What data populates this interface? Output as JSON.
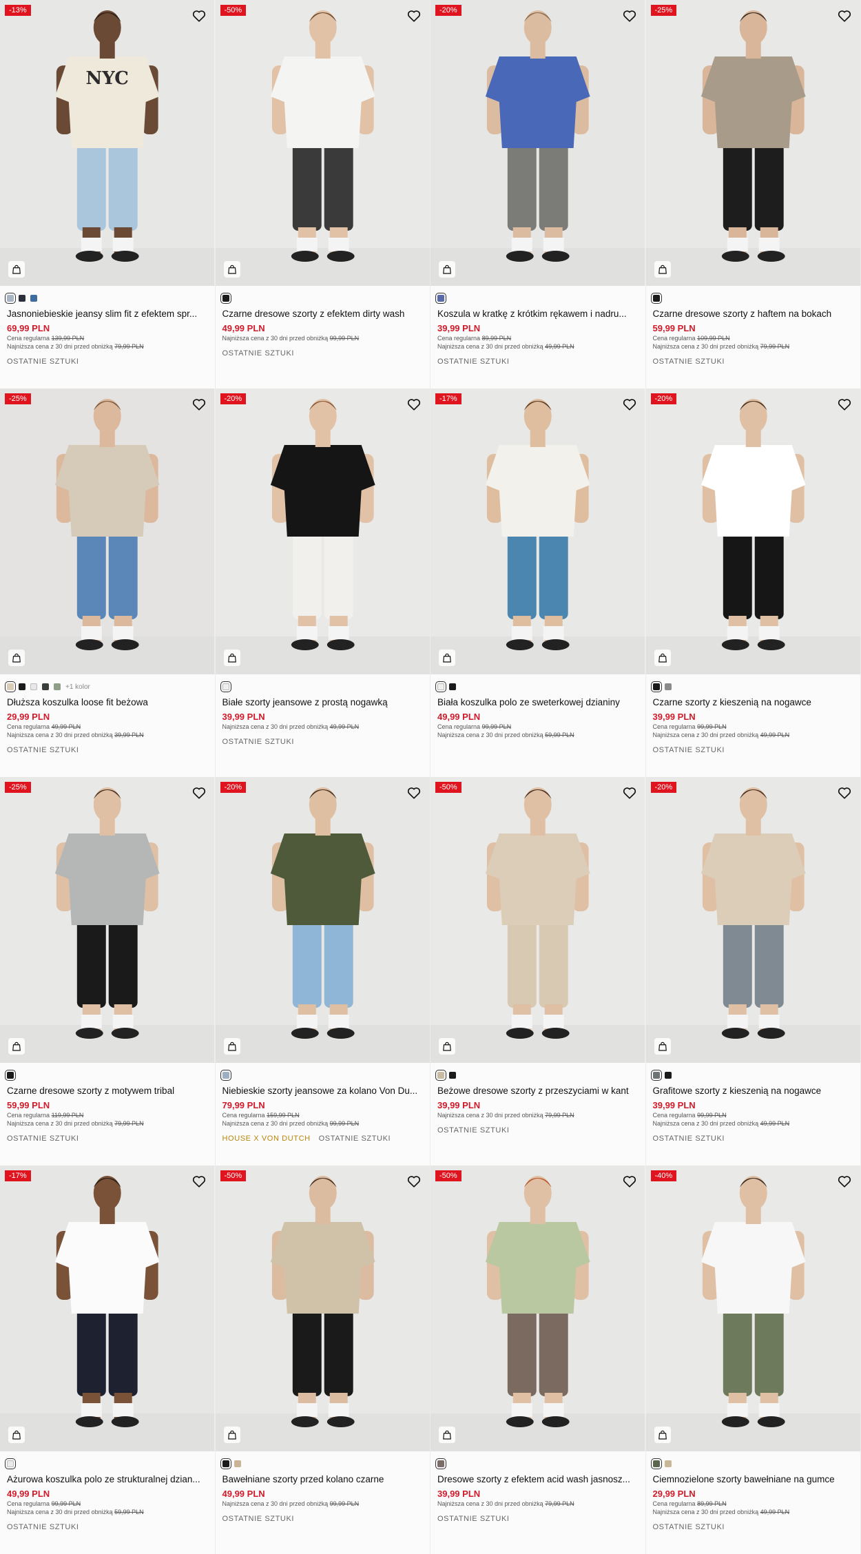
{
  "labels": {
    "regular": "Cena regularna",
    "lowest": "Najniższa cena z 30 dni przed obniżką"
  },
  "products": [
    {
      "badge": "-13%",
      "name": "Jasnoniebieskie jeansy slim fit z efektem spr...",
      "price": "69,99 PLN",
      "regular": "139,99 PLN",
      "lowest": "79,99 PLN",
      "tags": [
        "OSTATNIE SZTUKI"
      ],
      "swatches": [
        "#a8b6c4",
        "#2a2f3a",
        "#3e6c9c"
      ],
      "more": "",
      "top": "#efe9dc",
      "bottom": "#a9c6dc",
      "skin": "#6b4a35",
      "hair": "#2a1d16",
      "bg": "#e7e7e5",
      "print": "NYC"
    },
    {
      "badge": "-50%",
      "name": "Czarne dresowe szorty z efektem dirty wash",
      "price": "49,99 PLN",
      "regular": "",
      "lowest": "99,99 PLN",
      "tags": [
        "OSTATNIE SZTUKI"
      ],
      "swatches": [
        "#1b1b1b"
      ],
      "more": "",
      "top": "#f4f4f2",
      "bottom": "#3a3a3a",
      "skin": "#e2c2a6",
      "hair": "#6b4a2e",
      "bg": "#e9e9e7",
      "print": ""
    },
    {
      "badge": "-20%",
      "name": "Koszula w kratkę z krótkim rękawem i nadru...",
      "price": "39,99 PLN",
      "regular": "89,99 PLN",
      "lowest": "49,99 PLN",
      "tags": [
        "OSTATNIE SZTUKI"
      ],
      "swatches": [
        "#5a6aa8"
      ],
      "more": "",
      "top": "#4a68b8",
      "bottom": "#7b7b78",
      "skin": "#dcbca0",
      "hair": "#8a6a4e",
      "bg": "#e6e6e4",
      "print": ""
    },
    {
      "badge": "-25%",
      "name": "Czarne dresowe szorty z haftem na bokach",
      "price": "59,99 PLN",
      "regular": "109,99 PLN",
      "lowest": "79,99 PLN",
      "tags": [
        "OSTATNIE SZTUKI"
      ],
      "swatches": [
        "#1b1b1b"
      ],
      "more": "",
      "top": "#a99b8a",
      "bottom": "#1d1d1d",
      "skin": "#d9b69a",
      "hair": "#3a2a1e",
      "bg": "#e8e8e6",
      "print": ""
    },
    {
      "badge": "-25%",
      "name": "Dłuższa koszulka loose fit beżowa",
      "price": "29,99 PLN",
      "regular": "49,99 PLN",
      "lowest": "39,99 PLN",
      "tags": [
        "OSTATNIE SZTUKI"
      ],
      "swatches": [
        "#d8cdb6",
        "#1b1b1b",
        "#e8e8e8",
        "#3a3f3a",
        "#8f9e86"
      ],
      "more": "+1 kolor",
      "top": "#d6cbb8",
      "bottom": "#5a86b8",
      "skin": "#dcb89c",
      "hair": "#7a5a40",
      "bg": "#e4e3e1",
      "print": ""
    },
    {
      "badge": "-20%",
      "name": "Białe szorty jeansowe z prostą nogawką",
      "price": "39,99 PLN",
      "regular": "",
      "lowest": "49,99 PLN",
      "tags": [
        "OSTATNIE SZTUKI"
      ],
      "swatches": [
        "#eeeeec"
      ],
      "more": "",
      "top": "#151515",
      "bottom": "#f1f0ed",
      "skin": "#e2c2a6",
      "hair": "#8a5a3a",
      "bg": "#e9e9e7",
      "print": ""
    },
    {
      "badge": "-17%",
      "name": "Biała koszulka polo ze sweterkowej dzianiny",
      "price": "49,99 PLN",
      "regular": "99,99 PLN",
      "lowest": "59,99 PLN",
      "tags": [],
      "swatches": [
        "#eeeeea",
        "#1b1b1b"
      ],
      "more": "",
      "top": "#f2f1ec",
      "bottom": "#4a86b0",
      "skin": "#dfbea0",
      "hair": "#5a3a22",
      "bg": "#e8e8e6",
      "print": ""
    },
    {
      "badge": "-20%",
      "name": "Czarne szorty z kieszenią na nogawce",
      "price": "39,99 PLN",
      "regular": "99,99 PLN",
      "lowest": "49,99 PLN",
      "tags": [
        "OSTATNIE SZTUKI"
      ],
      "swatches": [
        "#1b1b1b",
        "#8a8a8a"
      ],
      "more": "",
      "top": "#ffffff",
      "bottom": "#161616",
      "skin": "#e0c0a4",
      "hair": "#4a3020",
      "bg": "#e9e9e7",
      "print": ""
    },
    {
      "badge": "-25%",
      "name": "Czarne dresowe szorty z motywem tribal",
      "price": "59,99 PLN",
      "regular": "119,99 PLN",
      "lowest": "79,99 PLN",
      "tags": [
        "OSTATNIE SZTUKI"
      ],
      "swatches": [
        "#1b1b1b"
      ],
      "more": "",
      "top": "#b5b7b6",
      "bottom": "#1a1a1a",
      "skin": "#e0c0a4",
      "hair": "#4a3020",
      "bg": "#e8e8e6",
      "print": ""
    },
    {
      "badge": "-20%",
      "name": "Niebieskie szorty jeansowe za kolano Von Du...",
      "price": "79,99 PLN",
      "regular": "159,99 PLN",
      "lowest": "99,99 PLN",
      "tags": [
        "HOUSE X VON DUTCH",
        "OSTATNIE SZTUKI"
      ],
      "swatches": [
        "#9cb0c2"
      ],
      "more": "",
      "top": "#4e5a3a",
      "bottom": "#8fb6d6",
      "skin": "#dfbfa2",
      "hair": "#4a3020",
      "bg": "#e7e7e5",
      "print": ""
    },
    {
      "badge": "-50%",
      "name": "Beżowe dresowe szorty z przeszyciami w kant",
      "price": "39,99 PLN",
      "regular": "",
      "lowest": "79,99 PLN",
      "tags": [
        "OSTATNIE SZTUKI"
      ],
      "swatches": [
        "#c9bba4",
        "#1b1b1b"
      ],
      "more": "",
      "top": "#dccdb8",
      "bottom": "#d8c9b2",
      "skin": "#e0c0a4",
      "hair": "#4a3020",
      "bg": "#e9e9e7",
      "print": ""
    },
    {
      "badge": "-20%",
      "name": "Grafitowe szorty z kieszenią na nogawce",
      "price": "39,99 PLN",
      "regular": "99,99 PLN",
      "lowest": "49,99 PLN",
      "tags": [
        "OSTATNIE SZTUKI"
      ],
      "swatches": [
        "#6e7376",
        "#1b1b1b"
      ],
      "more": "",
      "top": "#dccdb8",
      "bottom": "#7f8a92",
      "skin": "#e0c0a4",
      "hair": "#4a3020",
      "bg": "#e8e8e6",
      "print": ""
    },
    {
      "badge": "-17%",
      "name": "Ażurowa koszulka polo ze strukturalnej dzian...",
      "price": "49,99 PLN",
      "regular": "99,99 PLN",
      "lowest": "59,99 PLN",
      "tags": [
        "OSTATNIE SZTUKI"
      ],
      "swatches": [
        "#eaeaea"
      ],
      "more": "",
      "top": "#fbfbfb",
      "bottom": "#1e2230",
      "skin": "#7a5238",
      "hair": "#2a1d16",
      "bg": "#e6e6e4",
      "print": ""
    },
    {
      "badge": "-50%",
      "name": "Bawełniane szorty przed kolano czarne",
      "price": "49,99 PLN",
      "regular": "",
      "lowest": "99,99 PLN",
      "tags": [
        "OSTATNIE SZTUKI"
      ],
      "swatches": [
        "#1b1b1b",
        "#c9b498"
      ],
      "more": "",
      "top": "#cfc2a8",
      "bottom": "#1a1a1a",
      "skin": "#dcbca0",
      "hair": "#4a3020",
      "bg": "#e8e8e6",
      "print": ""
    },
    {
      "badge": "-50%",
      "name": "Dresowe szorty z efektem acid wash jasnosz...",
      "price": "39,99 PLN",
      "regular": "",
      "lowest": "79,99 PLN",
      "tags": [
        "OSTATNIE SZTUKI"
      ],
      "swatches": [
        "#7a6c66"
      ],
      "more": "",
      "top": "#b9c8a0",
      "bottom": "#7a6a60",
      "skin": "#e0c0a4",
      "hair": "#b85a30",
      "bg": "#e7e7e5",
      "print": ""
    },
    {
      "badge": "-40%",
      "name": "Ciemnozielone szorty bawełniane na gumce",
      "price": "29,99 PLN",
      "regular": "89,99 PLN",
      "lowest": "49,99 PLN",
      "tags": [
        "OSTATNIE SZTUKI"
      ],
      "swatches": [
        "#5a6650",
        "#c9b898"
      ],
      "more": "",
      "top": "#f7f7f7",
      "bottom": "#6e7a5c",
      "skin": "#e0c0a4",
      "hair": "#3a2a1e",
      "bg": "#e9e9e7",
      "print": ""
    }
  ]
}
